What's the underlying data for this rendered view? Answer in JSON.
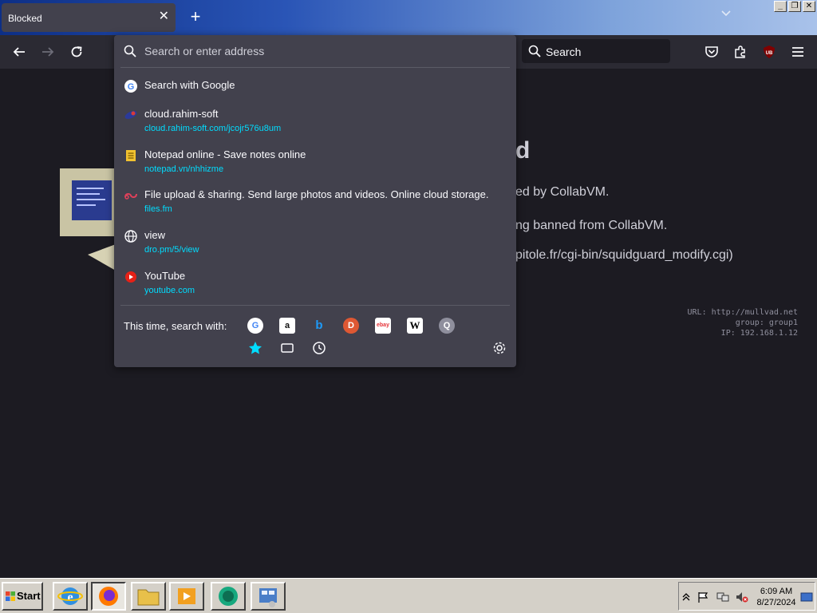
{
  "window": {
    "tab_title": "Blocked",
    "tab_close_icon": "close-icon",
    "new_tab_icon": "plus-icon",
    "tab_list_icon": "chevron-down-icon",
    "win_minimize": "_",
    "win_restore": "❐",
    "win_close": "✕"
  },
  "toolbar": {
    "back_icon": "back-arrow-icon",
    "forward_icon": "forward-arrow-icon",
    "reload_icon": "reload-icon",
    "search_label": "Search",
    "pocket_icon": "pocket-icon",
    "extensions_icon": "puzzle-icon",
    "ublock_icon": "ublock-icon",
    "ublock_label": "UB",
    "menu_icon": "hamburger-menu-icon"
  },
  "page": {
    "heading_tail": "d",
    "line1": "ed by CollabVM.",
    "line2": "ng banned from CollabVM.",
    "line3": "pitole.fr/cgi-bin/squidguard_modify.cgi)",
    "info_url": "URL: http://mullvad.net",
    "info_group": "group: group1",
    "info_ip": "IP: 192.168.1.12"
  },
  "urlbar": {
    "placeholder": "Search or enter address",
    "value": "",
    "search_with_google": "Search with Google",
    "results": [
      {
        "title": "cloud.rahim-soft",
        "url": "cloud.rahim-soft.com/jcojr576u8um",
        "icon": "rahim-soft-icon"
      },
      {
        "title": "Notepad online - Save notes online",
        "url": "notepad.vn/nhhizme",
        "icon": "notepad-icon"
      },
      {
        "title": "File upload & sharing. Send large photos and videos. Online cloud storage.",
        "url": "files.fm",
        "icon": "files-fm-icon"
      },
      {
        "title": "view",
        "url": "dro.pm/5/view",
        "icon": "globe-icon"
      },
      {
        "title": "YouTube",
        "url": "youtube.com",
        "icon": "youtube-icon"
      }
    ],
    "this_time_label": "This time, search with:",
    "engines": [
      {
        "name": "google-icon",
        "glyph": "G"
      },
      {
        "name": "amazon-icon",
        "glyph": "a"
      },
      {
        "name": "bing-icon",
        "glyph": "b"
      },
      {
        "name": "duckduckgo-icon",
        "glyph": "D"
      },
      {
        "name": "ebay-icon",
        "glyph": "ebay"
      },
      {
        "name": "wikipedia-icon",
        "glyph": "W"
      },
      {
        "name": "search-engine-icon",
        "glyph": "Q"
      }
    ],
    "modes": [
      "bookmarks-star-icon",
      "tabs-icon",
      "history-clock-icon"
    ],
    "settings_icon": "gear-icon"
  },
  "taskbar": {
    "start_label": "Start",
    "apps": [
      "internet-explorer-icon",
      "firefox-icon",
      "folder-icon",
      "media-player-icon",
      "messenger-icon",
      "control-panel-icon"
    ],
    "time": "6:09 AM",
    "date": "8/27/2024"
  },
  "colors": {
    "url_text": "#00ddff",
    "dropdown_bg": "#42414d",
    "page_bg": "#1c1b22",
    "toolbar_bg": "#2b2a33",
    "accent_blue": "#00ddff"
  }
}
